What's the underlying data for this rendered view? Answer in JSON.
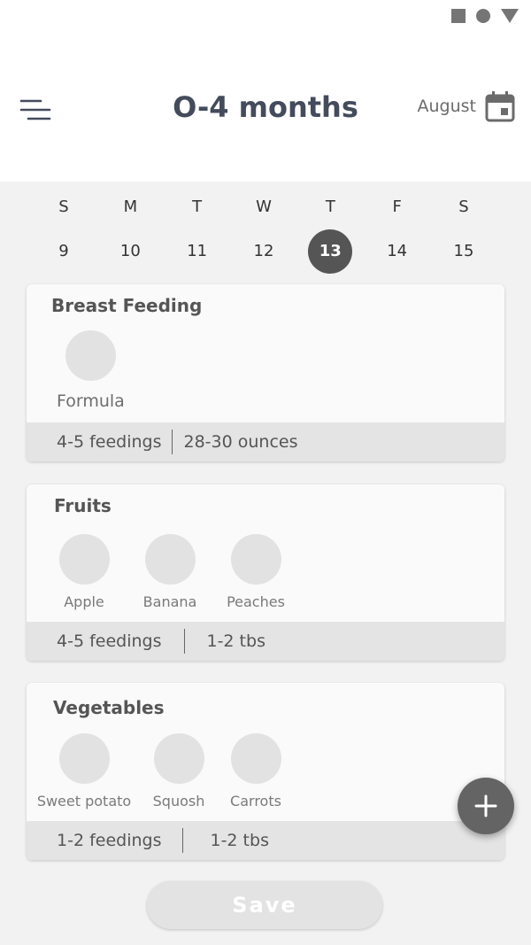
{
  "header": {
    "title": "O-4 months",
    "month": "August",
    "menu_icon": "menu-icon",
    "calendar_icon": "calendar-icon"
  },
  "week": {
    "days": [
      {
        "letter": "S",
        "date": "9"
      },
      {
        "letter": "M",
        "date": "10"
      },
      {
        "letter": "T",
        "date": "11"
      },
      {
        "letter": "W",
        "date": "12"
      },
      {
        "letter": "T",
        "date": "13",
        "selected": true
      },
      {
        "letter": "F",
        "date": "14"
      },
      {
        "letter": "S",
        "date": "15"
      }
    ]
  },
  "sections": [
    {
      "title": "Breast Feeding",
      "foods": [
        "Formula"
      ],
      "feedings": "4-5 feedings",
      "amount": "28-30 ounces"
    },
    {
      "title": "Fruits",
      "foods": [
        "Apple",
        "Banana",
        "Peaches"
      ],
      "feedings": "4-5 feedings",
      "amount": "1-2 tbs"
    },
    {
      "title": "Vegetables",
      "foods": [
        "Sweet potato",
        "Squosh",
        "Carrots"
      ],
      "feedings": "1-2 feedings",
      "amount": "1-2 tbs"
    }
  ],
  "fab": {
    "icon": "plus-icon"
  },
  "save_label": "Save",
  "colors": {
    "title": "#434b5c",
    "selected_day": "#555555",
    "fab": "#646464",
    "background": "#f2f2f2",
    "food_placeholder": "#e2e2e2"
  }
}
